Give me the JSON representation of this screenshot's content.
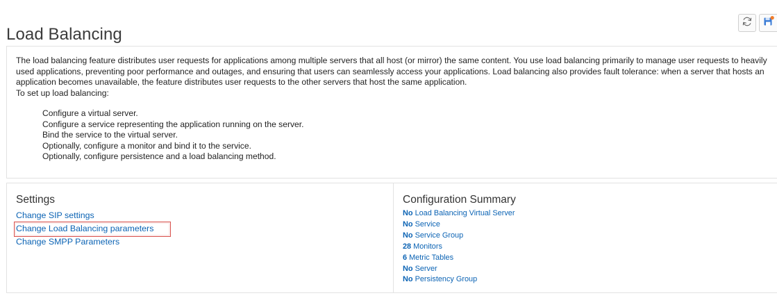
{
  "page": {
    "title": "Load Balancing"
  },
  "toolbar": {
    "refresh_icon": "refresh-icon",
    "save_icon": "save-icon",
    "save_badge_color": "#f07c2a"
  },
  "description": {
    "paragraph": "The load balancing feature distributes user requests for applications among multiple servers that all host (or mirror) the same content. You use load balancing primarily to manage user requests to heavily used applications, preventing poor performance and outages, and ensuring that users can seamlessly access your applications. Load balancing also provides fault tolerance: when a server that hosts an application becomes unavailable, the feature distributes user requests to the other servers that host the same application.",
    "intro": "To set up load balancing:",
    "steps": [
      "Configure a virtual server.",
      "Configure a service representing the application running on the server.",
      "Bind the service to the virtual server.",
      "Optionally, configure a monitor and bind it to the service.",
      "Optionally, configure persistence and a load balancing method."
    ]
  },
  "settings": {
    "heading": "Settings",
    "links": [
      "Change SIP settings",
      "Change Load Balancing parameters",
      "Change SMPP Parameters"
    ],
    "highlight_color": "#d9534f"
  },
  "summary": {
    "heading": "Configuration Summary",
    "items": [
      {
        "count": "No",
        "label": "Load Balancing Virtual Server"
      },
      {
        "count": "No",
        "label": "Service"
      },
      {
        "count": "No",
        "label": "Service Group"
      },
      {
        "count": "28",
        "label": "Monitors"
      },
      {
        "count": "6",
        "label": "Metric Tables"
      },
      {
        "count": "No",
        "label": "Server"
      },
      {
        "count": "No",
        "label": "Persistency Group"
      }
    ]
  },
  "colors": {
    "link": "#0b63b4",
    "border": "#e2e2e2",
    "title": "#3b3b3b"
  }
}
